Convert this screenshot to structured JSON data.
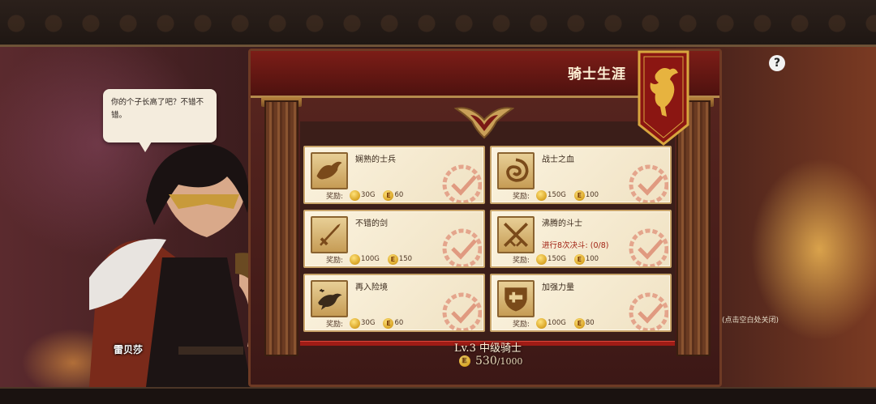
{
  "board_title": "骑士生涯",
  "help_label": "?",
  "close_hint": "(点击空白处关闭)",
  "speech_text": "你的个子长高了吧？不错不错。",
  "character_name": "雷贝莎",
  "level_text": "Lv.3 中级骑士",
  "exp": {
    "current": "530",
    "max": "/1000"
  },
  "colors": {
    "accent": "#a01c16",
    "card_bg": "#fbf3df",
    "banner": "#8b1612"
  },
  "achievements": [
    {
      "title": "娴熟的士兵",
      "reward_label": "奖励:",
      "gold": "30G",
      "e": "60",
      "progress": "",
      "icon": "eagle-icon"
    },
    {
      "title": "战士之血",
      "reward_label": "奖励:",
      "gold": "150G",
      "e": "100",
      "progress": "",
      "icon": "swirl-icon"
    },
    {
      "title": "不错的剑",
      "reward_label": "奖励:",
      "gold": "100G",
      "e": "150",
      "progress": "",
      "icon": "sword-icon"
    },
    {
      "title": "沸腾的斗士",
      "reward_label": "奖励:",
      "gold": "150G",
      "e": "100",
      "progress": "进行8次决斗: (0/8)",
      "icon": "crossed-swords-icon"
    },
    {
      "title": "再入险境",
      "reward_label": "奖励:",
      "gold": "30G",
      "e": "60",
      "progress": "",
      "icon": "raven-icon"
    },
    {
      "title": "加强力量",
      "reward_label": "奖励:",
      "gold": "100G",
      "e": "80",
      "progress": "",
      "icon": "shield-icon"
    }
  ]
}
